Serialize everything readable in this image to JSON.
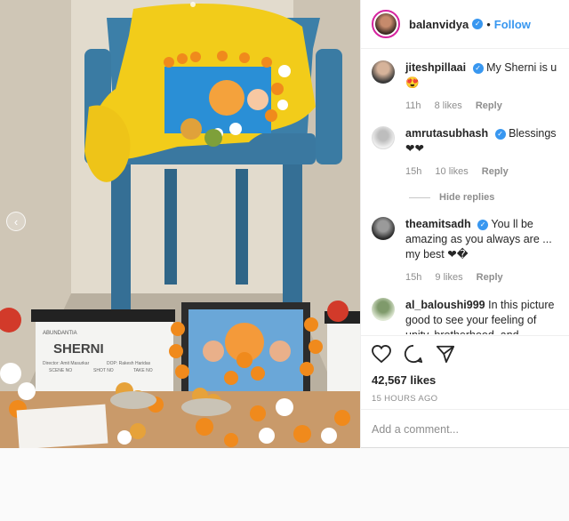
{
  "post": {
    "image": {
      "clapboard_title": "SHERNI",
      "clapboard_brand": "ABUNDANTIA",
      "clapboard_director": "Director: Amit Masurkar",
      "clapboard_dop": "DOP: Rakesh Haridas",
      "clapboard_fields": [
        "SCENE NO",
        "SHOT NO",
        "TAKE NO"
      ]
    },
    "author": {
      "username": "balanvidya",
      "follow_label": "Follow"
    },
    "comments": [
      {
        "username": "jiteshpillaai",
        "verified": true,
        "text": "My Sherni is u 😍",
        "time": "11h",
        "likes": "8 likes",
        "reply": "Reply"
      },
      {
        "username": "amrutasubhash",
        "verified": true,
        "text": "Blessings ❤❤",
        "time": "15h",
        "likes": "10 likes",
        "reply": "Reply"
      },
      {
        "username": "theamitsadh",
        "verified": true,
        "text": "You ll be amazing as you always are ... my best ❤�",
        "time": "15h",
        "likes": "9 likes",
        "reply": "Reply"
      },
      {
        "username": "al_baloushi999",
        "verified": false,
        "text": "In this picture good to see your feeling of unity, brotherhood, and religious harmony... Pray for peaceful, prosperous and United India....🙏",
        "time": "",
        "likes": "",
        "reply": ""
      }
    ],
    "hide_replies": "Hide replies",
    "likes": "42,567 likes",
    "timestamp": "15 HOURS AGO",
    "add_comment_placeholder": "Add a comment..."
  },
  "colors": {
    "link": "#3897f0",
    "muted": "#8e8e8e",
    "chair": "#3c7fa8",
    "cloth": "#f2cc1a",
    "marigold": "#f08a1c"
  },
  "icons": [
    "heart-icon",
    "comment-icon",
    "share-icon",
    "verified-badge-icon",
    "chevron-left-icon"
  ]
}
